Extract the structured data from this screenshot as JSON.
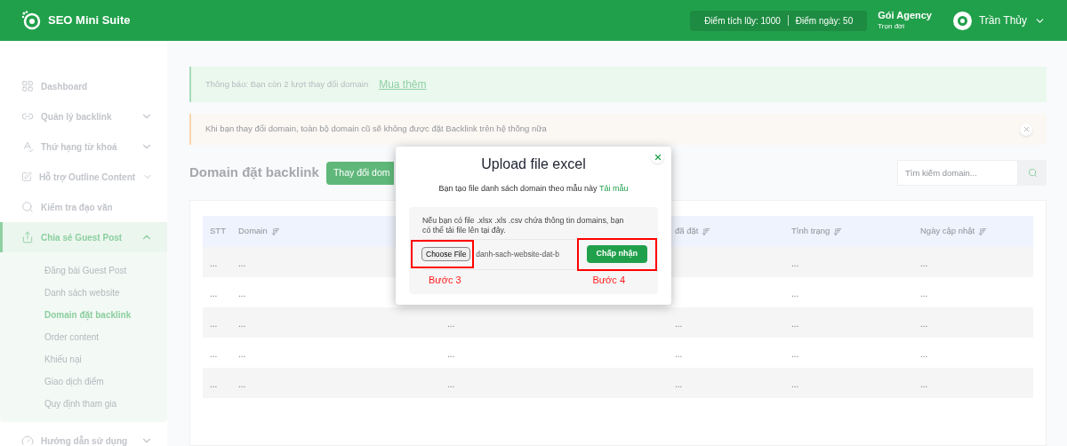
{
  "header": {
    "brand": "SEO Mini Suite",
    "points": {
      "accumulated": "Điểm tích lũy: 1000",
      "daily": "Điểm ngày: 50"
    },
    "plan": {
      "name": "Gói Agency",
      "term": "Trọn đời"
    },
    "user": {
      "name": "Trần Thủy"
    }
  },
  "sidebar": {
    "items": [
      {
        "kind": "link",
        "label": "Dashboard",
        "selected": false
      },
      {
        "kind": "group",
        "label": "Quản lý backlink",
        "selected": false,
        "expanded": false
      },
      {
        "kind": "group",
        "label": "Thứ hạng từ khoá",
        "selected": false,
        "expanded": false
      },
      {
        "kind": "group",
        "label": "Hỗ trợ Outline Content",
        "selected": false,
        "expanded": false
      },
      {
        "kind": "link",
        "label": "Kiểm tra đạo văn",
        "selected": false
      },
      {
        "kind": "group",
        "label": "Chia sẻ Guest Post",
        "selected": true,
        "expanded": true,
        "children": [
          {
            "label": "Đăng bài Guest Post",
            "selected": false
          },
          {
            "label": "Danh sách website",
            "selected": false
          },
          {
            "label": "Domain đặt backlink",
            "selected": true
          },
          {
            "label": "Order content",
            "selected": false
          },
          {
            "label": "Khiếu nại",
            "selected": false
          },
          {
            "label": "Giao dịch điểm",
            "selected": false
          },
          {
            "label": "Quy định tham gia",
            "selected": false
          }
        ]
      },
      {
        "kind": "group",
        "label": "Hướng dẫn sử dụng",
        "selected": false,
        "expanded": false
      }
    ]
  },
  "notice": {
    "text": "Thông báo: Bạn còn 2 lượt thay đổi domain",
    "link": "Mua thêm"
  },
  "warning": {
    "text": "Khi bạn thay đổi domain, toàn bộ domain cũ sẽ không được đặt Backlink trên hệ thống nữa"
  },
  "page_title": "Domain đặt backlink",
  "change_button": "Thay đổi dom",
  "search": {
    "placeholder": "Tìm kiếm domain..."
  },
  "table": {
    "columns": [
      {
        "label": "STT",
        "sortable": false
      },
      {
        "label": "Domain",
        "sortable": true
      },
      {},
      {
        "label": "đã đặt",
        "sortable": true
      },
      {
        "label": "Tình trạng",
        "sortable": true
      },
      {
        "label": "Ngày cập nhật",
        "sortable": true
      }
    ],
    "rows": [
      [
        "...",
        "...",
        null,
        null,
        "...",
        "..."
      ],
      [
        "...",
        "...",
        null,
        null,
        "...",
        "..."
      ],
      [
        "...",
        "...",
        "...",
        "...",
        "...",
        "..."
      ],
      [
        "...",
        "...",
        "...",
        "...",
        "...",
        "..."
      ],
      [
        "...",
        "...",
        "...",
        "...",
        "...",
        "..."
      ]
    ]
  },
  "modal": {
    "title": "Upload file excel",
    "hint": "Bạn tạo file danh sách domain theo mẫu này",
    "hint_link": "Tải mẫu",
    "upload_hint": "Nếu bạn có file .xlsx .xls .csv chứa thông tin domains, bạn có thể tải file lên tại đây.",
    "file_button": "Choose File",
    "file_name": "danh-sach-website-dat-b",
    "submit": "Chấp nhận",
    "steps": [
      "Bước 3",
      "Bước 4"
    ]
  }
}
